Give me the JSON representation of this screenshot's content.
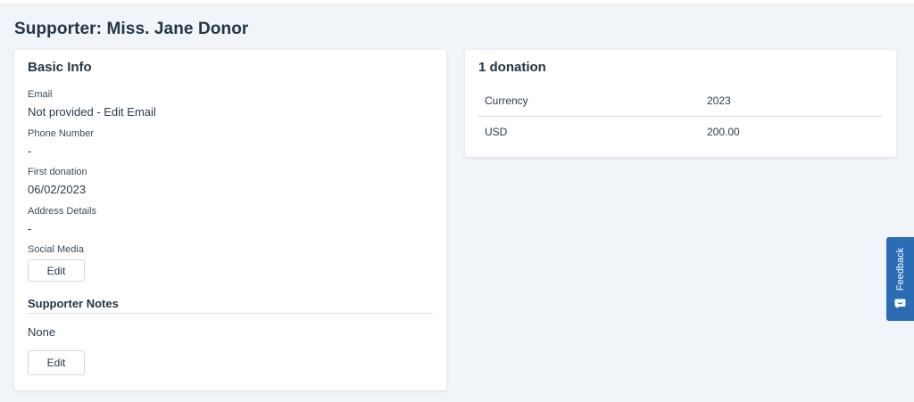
{
  "page": {
    "title": "Supporter: Miss. Jane Donor"
  },
  "basic_info": {
    "heading": "Basic Info",
    "email": {
      "label": "Email",
      "value": "Not provided - ",
      "link": "Edit Email"
    },
    "phone": {
      "label": "Phone Number",
      "value": "-"
    },
    "first_donation": {
      "label": "First donation",
      "value": "06/02/2023"
    },
    "address": {
      "label": "Address Details",
      "value": "-"
    },
    "social_media": {
      "label": "Social Media",
      "edit_label": "Edit"
    },
    "notes": {
      "heading": "Supporter Notes",
      "value": "None",
      "edit_label": "Edit"
    }
  },
  "donations": {
    "heading": "1 donation",
    "columns": [
      "Currency",
      "2023"
    ],
    "rows": [
      [
        "USD",
        "200.00"
      ]
    ]
  },
  "feedback": {
    "label": "Feedback",
    "icon": "chat-bubble-icon",
    "color": "#2a6db5"
  }
}
